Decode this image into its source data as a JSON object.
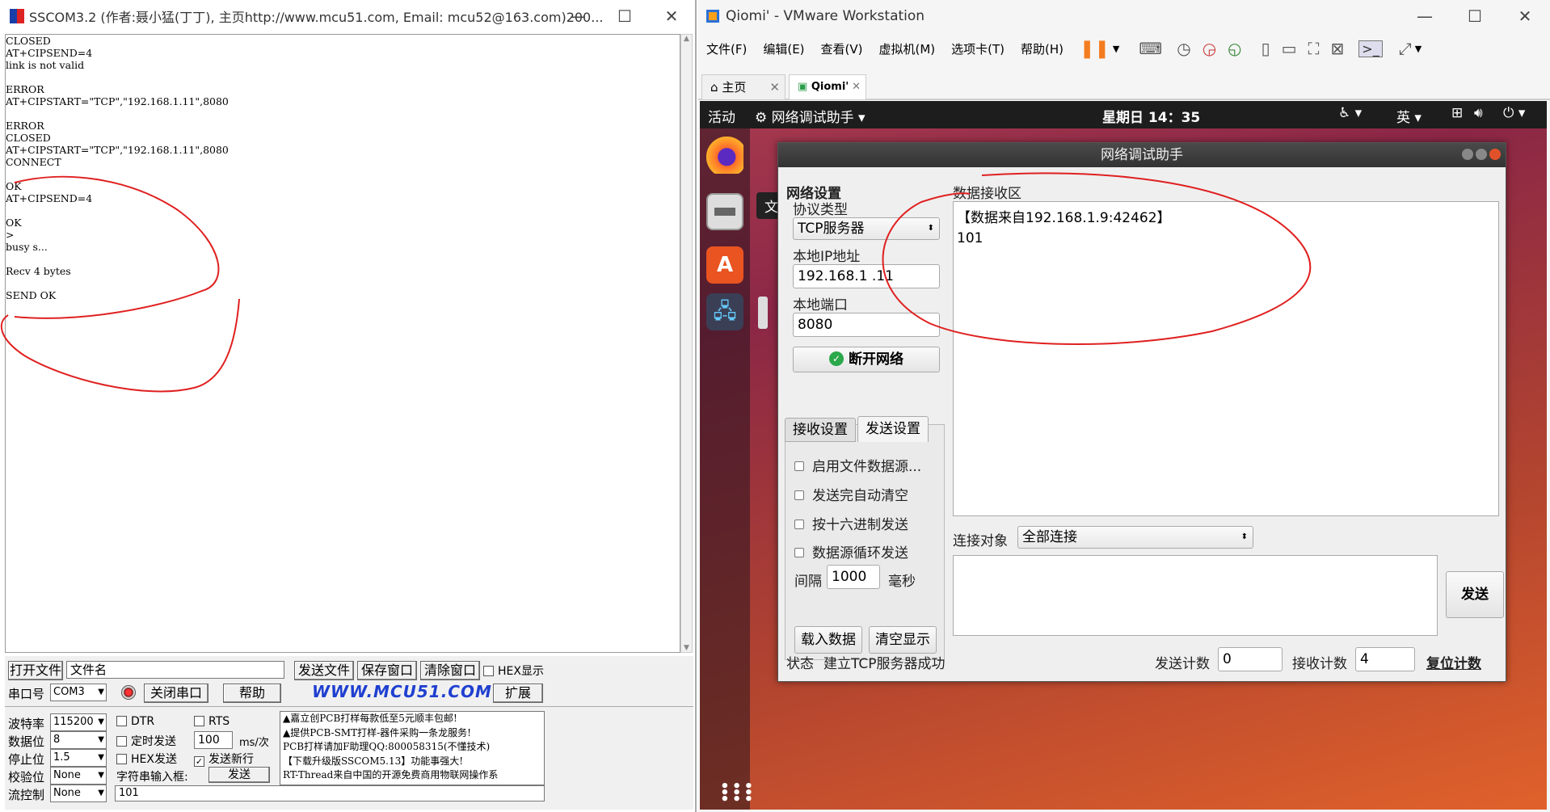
{
  "sscom": {
    "title": "SSCOM3.2 (作者:聂小猛(丁丁), 主页http://www.mcu51.com,  Email: mcu52@163.com)200...",
    "log": [
      "CLOSED",
      "AT+CIPSEND=4",
      "link is not valid",
      "",
      "ERROR",
      "AT+CIPSTART=\"TCP\",\"192.168.1.11\",8080",
      "",
      "ERROR",
      "CLOSED",
      "AT+CIPSTART=\"TCP\",\"192.168.1.11\",8080",
      "CONNECT",
      "",
      "OK",
      "AT+CIPSEND=4",
      "",
      "OK",
      ">",
      "busy s...",
      "",
      "Recv 4 bytes",
      "",
      "SEND OK"
    ],
    "open_file": "打开文件",
    "filename": "文件名",
    "send_file": "发送文件",
    "save_window": "保存窗口",
    "clear_window": "清除窗口",
    "hex_display": "HEX显示",
    "port_label": "串口号",
    "port_value": "COM3",
    "close_port": "关闭串口",
    "help": "帮助",
    "site": "WWW.MCU51.COM",
    "expand": "扩展",
    "baud_label": "波特率",
    "baud_value": "115200",
    "databits_label": "数据位",
    "databits_value": "8",
    "stopbits_label": "停止位",
    "stopbits_value": "1.5",
    "parity_label": "校验位",
    "parity_value": "None",
    "flow_label": "流控制",
    "flow_value": "None",
    "dtr": "DTR",
    "rts": "RTS",
    "timed_send": "定时发送",
    "interval_value": "100",
    "interval_unit": "ms/次",
    "hex_send": "HEX发送",
    "send_newline": "发送新行",
    "input_label": "字符串输入框:",
    "send": "发送",
    "input_value": "101",
    "ads": [
      "▲嘉立创PCB打样每款低至5元顺丰包邮!",
      "▲提供PCB-SMT打样-器件采购一条龙服务!",
      "PCB打样请加F助理QQ:800058315(不懂技术)",
      "【下载升级版SSCOM5.13】功能事强大!",
      "RT-Thread来自中国的开源免费商用物联网操作系"
    ]
  },
  "vmware": {
    "title": "Qiomi' - VMware Workstation",
    "menu": [
      "文件(F)",
      "编辑(E)",
      "查看(V)",
      "虚拟机(M)",
      "选项卡(T)",
      "帮助(H)"
    ],
    "tab_home": "主页",
    "tab_vm": "Qiomi'",
    "activities": "活动",
    "app_menu": "网络调试助手 ▾",
    "clock": "星期日 14：35",
    "ime": "英 ▾",
    "tooltip": "文件",
    "assistant": {
      "title": "网络调试助手",
      "net_settings": "网络设置",
      "protocol_label": "协议类型",
      "protocol_value": "TCP服务器",
      "ip_label": "本地IP地址",
      "ip_value": "192.168.1  .11",
      "port_label": "本地端口",
      "port_value": "8080",
      "disconnect": "断开网络",
      "tab_recv": "接收设置",
      "tab_send": "发送设置",
      "options": [
        "启用文件数据源...",
        "发送完自动清空",
        "按十六进制发送",
        "数据源循环发送"
      ],
      "interval_label": "间隔",
      "interval_value": "1000",
      "interval_unit": "毫秒",
      "load_data": "载入数据",
      "clear_display": "清空显示",
      "recv_area_label": "数据接收区",
      "recv_line1": "【数据来自192.168.1.9:42462】",
      "recv_line2": "101",
      "target_label": "连接对象",
      "target_value": "全部连接",
      "send": "发送",
      "status_label": "状态",
      "status_value": "建立TCP服务器成功",
      "send_count_label": "发送计数",
      "send_count": "0",
      "recv_count_label": "接收计数",
      "recv_count": "4",
      "reset_count": "复位计数"
    }
  }
}
